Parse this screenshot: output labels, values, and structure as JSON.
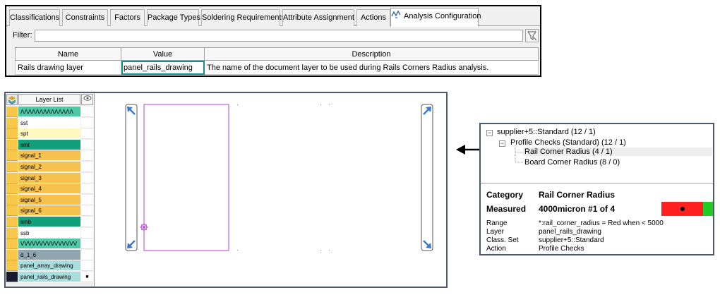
{
  "tabs": [
    {
      "label": "Classifications",
      "active": false
    },
    {
      "label": "Constraints",
      "active": false
    },
    {
      "label": "Factors",
      "active": false
    },
    {
      "label": "Package Types",
      "active": false
    },
    {
      "label": "Soldering Requirements",
      "active": false
    },
    {
      "label": "Attribute Assignment",
      "active": false
    },
    {
      "label": "Actions",
      "active": false
    },
    {
      "label": "Analysis Configuration",
      "active": true,
      "icon": "analysis-config-icon"
    }
  ],
  "filter": {
    "label": "Filter:",
    "value": "",
    "placeholder": ""
  },
  "param_table": {
    "headers": [
      "Name",
      "Value",
      "Description"
    ],
    "rows": [
      {
        "name": "Rails drawing layer",
        "value": "panel_rails_drawing",
        "description": "The name of the document layer to be used during Rails Corners Radius analysis."
      }
    ]
  },
  "layer_list": {
    "header": "Layer List",
    "layers": [
      {
        "name": "ΛΛΛΛΛΛΛΛΛΛΛΛΛΛ",
        "color": "#4ec9a8"
      },
      {
        "name": "sst",
        "color": "#ffffff"
      },
      {
        "name": "spt",
        "color": "#fff8c0"
      },
      {
        "name": "smt",
        "color": "#12a07a"
      },
      {
        "name": "signal_1",
        "color": "#f6c24d"
      },
      {
        "name": "signal_2",
        "color": "#f6c24d"
      },
      {
        "name": "signal_3",
        "color": "#f6c24d"
      },
      {
        "name": "signal_4",
        "color": "#f6c24d"
      },
      {
        "name": "signal_5",
        "color": "#f6c24d"
      },
      {
        "name": "signal_6",
        "color": "#f6c24d"
      },
      {
        "name": "smb",
        "color": "#12a07a"
      },
      {
        "name": "ssb",
        "color": "#ffffff"
      },
      {
        "name": "VVVVVVVVVVVVVVV",
        "color": "#4ec9a8"
      },
      {
        "name": "d_1_6",
        "color": "#8fa6b0"
      },
      {
        "name": "panel_array_drawing",
        "color": "#a8dede"
      },
      {
        "name": "panel_rails_drawing",
        "color": "#a8dede",
        "selected": true
      }
    ]
  },
  "results": {
    "tree": [
      {
        "label": "supplier+5::Standard (12 / 1)",
        "level": 0,
        "expander": "⊟"
      },
      {
        "label": "Profile Checks (Standard) (12 / 1)",
        "level": 1,
        "expander": "⊟"
      },
      {
        "label": "Rail Corner Radius (4 / 1)",
        "level": 2,
        "selected": true
      },
      {
        "label": "Board Corner Radius (8 / 0)",
        "level": 2
      }
    ],
    "category_label": "Category",
    "category_value": "Rail Corner Radius",
    "measured_label": "Measured",
    "measured_value": "4000micron #1 of 4",
    "details": [
      {
        "key": "Range",
        "value": "*:rail_corner_radius = Red when < 5000"
      },
      {
        "key": "Layer",
        "value": "panel_rails_drawing"
      },
      {
        "key": "Class. Set",
        "value": "supplier+5::Standard"
      },
      {
        "key": "Action",
        "value": "Profile Checks"
      }
    ],
    "status_colors": {
      "fail": "#ff2020",
      "pass": "#22cc22"
    }
  },
  "colors": {
    "accent_teal": "#1a8c8c",
    "rail_arrow": "#3a78c8",
    "board_outline": "#b040d0",
    "panel_border": "#4a5a6a"
  }
}
